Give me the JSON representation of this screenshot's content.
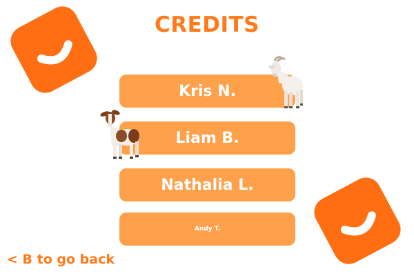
{
  "screen": {
    "title": "CREDITS",
    "back_hint": "< B to go back"
  },
  "credits": [
    "Kris N.",
    "Liam B.",
    "Nathalia L.",
    "Andy T."
  ],
  "colors": {
    "background": "#ffffff",
    "title": "#ff7a1a",
    "logo": "#ff6e12",
    "button": "#ffa04b",
    "button_text": "#ffffff"
  },
  "icons": [
    "app-logo-icon",
    "goat-icon"
  ]
}
